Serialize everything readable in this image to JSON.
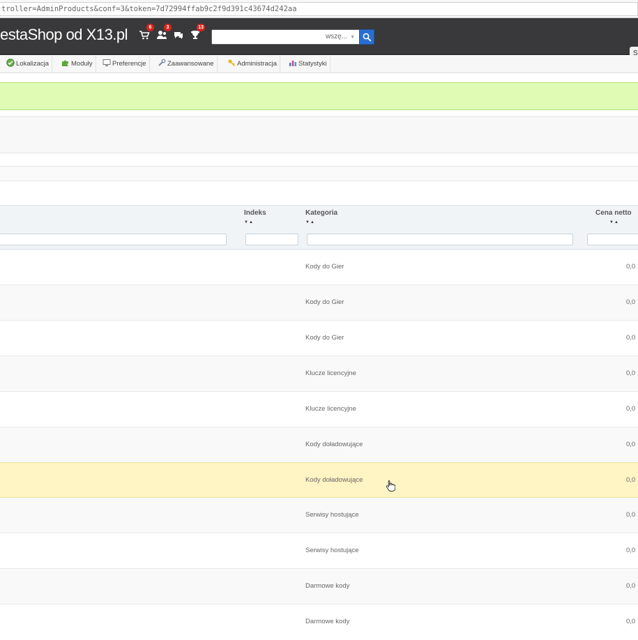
{
  "browser": {
    "url": "troller=AdminProducts&conf=3&token=7d72994ffab9c2f9d391c43674d242aa"
  },
  "header": {
    "shop_title": "estaShop od X13.pl",
    "badges": {
      "orders": "6",
      "customers": "3",
      "trophy": "13"
    },
    "search": {
      "placeholder": "",
      "scope": "wszę..."
    },
    "right_button": "S"
  },
  "menu": {
    "items": [
      {
        "label": "Lokalizacja",
        "icon": "globe-icon"
      },
      {
        "label": "Moduły",
        "icon": "puzzle-icon"
      },
      {
        "label": "Preferencje",
        "icon": "monitor-icon"
      },
      {
        "label": "Zaawansowane",
        "icon": "wrench-icon"
      },
      {
        "label": "Administracja",
        "icon": "key-icon"
      },
      {
        "label": "Statystyki",
        "icon": "chart-icon"
      }
    ]
  },
  "table": {
    "columns": {
      "index": "Indeks",
      "category": "Kategoria",
      "price": "Cena netto"
    },
    "sort_icons": "▼▲",
    "rows": [
      {
        "category": "Kody do Gier",
        "price": "0,0"
      },
      {
        "category": "Kody do Gier",
        "price": "0,0"
      },
      {
        "category": "Kody do Gier",
        "price": "0,0"
      },
      {
        "category": "Klucze licencyjne",
        "price": "0,0"
      },
      {
        "category": "Klucze licencyjne",
        "price": "0,0"
      },
      {
        "category": "Kody doładowujące",
        "price": "0,0"
      },
      {
        "category": "Kody doładowujące",
        "price": "0,0"
      },
      {
        "category": "Serwisy hostujące",
        "price": "0,0"
      },
      {
        "category": "Serwisy hostujące",
        "price": "0,0"
      },
      {
        "category": "Darmowe kody",
        "price": "0,0"
      },
      {
        "category": "Darmowe kody",
        "price": "0,0"
      }
    ]
  },
  "colors": {
    "header_bg": "#39393b",
    "success_bg": "#dffbb4",
    "highlight_row": "#fff4c3",
    "search_button": "#2a6fd0"
  }
}
